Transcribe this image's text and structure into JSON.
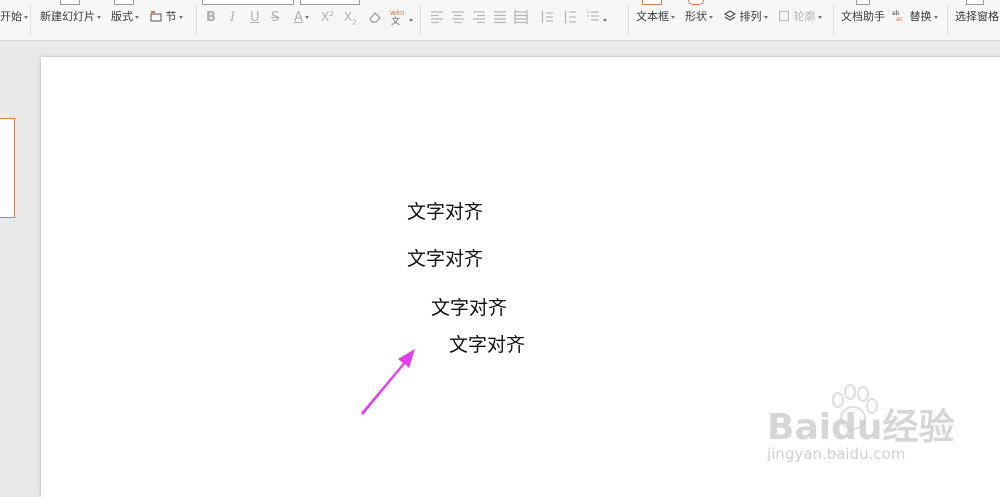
{
  "ribbon": {
    "start_label": "开始",
    "new_slide_label": "新建幻灯片",
    "layout_label": "版式",
    "section_label": "节",
    "text_box_label": "文本框",
    "shape_label": "形状",
    "arrange_label": "排列",
    "outline_label": "轮廓",
    "doc_assistant_label": "文档助手",
    "replace_label": "替换",
    "selection_pane_label": "选择窗格"
  },
  "slide": {
    "lines": [
      "文字对齐",
      "文字对齐",
      "文字对齐",
      "文字对齐"
    ]
  },
  "annotation": {
    "arrow_color": "#e23ee8"
  },
  "watermark": {
    "brand": "Baidu经验",
    "url": "jingyan.baidu.com"
  }
}
